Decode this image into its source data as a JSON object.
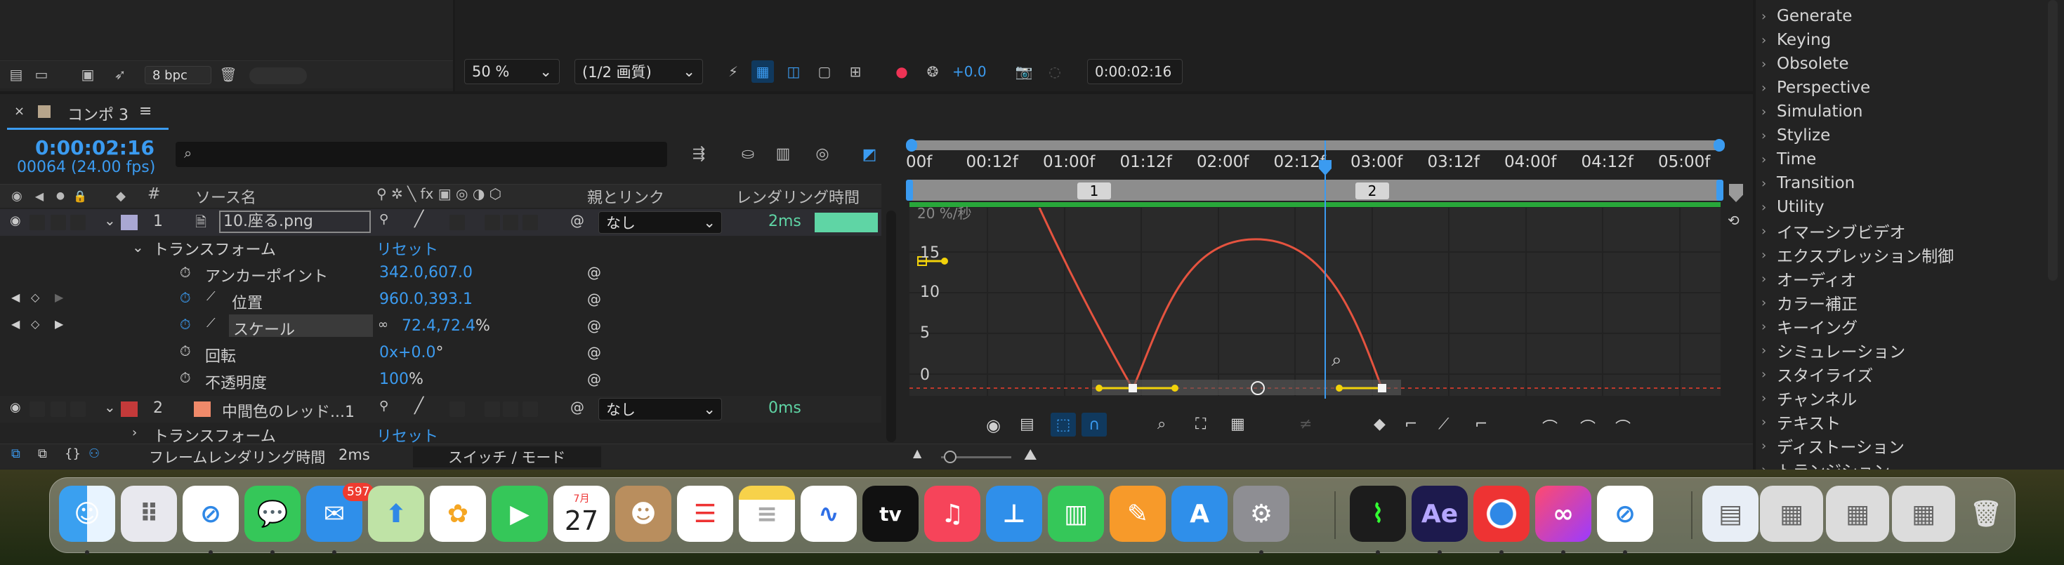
{
  "top_bar": {
    "bpc": "8 bpc"
  },
  "viewer_toolbar": {
    "zoom": "50 %",
    "resolution": "(1/2 画質)",
    "exposure": "+0.0",
    "timecode": "0:00:02:16"
  },
  "comp_tab": {
    "title": "コンポ 3"
  },
  "timeline": {
    "current_time": "0:00:02:16",
    "frame_info": "00064 (24.00 fps)",
    "col_source": "ソース名",
    "col_parent": "親とリンク",
    "col_render": "レンダリング時間",
    "col_num": "#",
    "layers": [
      {
        "num": "1",
        "name": "10.座る.png",
        "parent": "なし",
        "render": "2ms",
        "color": "#a9a7d3"
      },
      {
        "num": "2",
        "name": "中間色のレッド...1",
        "parent": "なし",
        "render": "0ms",
        "color": "#c43a3a"
      }
    ],
    "transform_label": "トランスフォーム",
    "reset": "リセット",
    "props": [
      {
        "name": "アンカーポイント",
        "value": "342.0,607.0"
      },
      {
        "name": "位置",
        "value": "960.0,393.1"
      },
      {
        "name": "スケール",
        "value": "72.4,72.4",
        "unit": "%"
      },
      {
        "name": "回転",
        "value": "0x+0.0",
        "unit": "°"
      },
      {
        "name": "不透明度",
        "value": "100",
        "unit": "%"
      }
    ],
    "transform2": "トランスフォーム",
    "reset2": "リセット",
    "footer_render_label": "フレームレンダリング時間",
    "footer_render_value": "2ms",
    "footer_switch": "スイッチ / モード"
  },
  "ruler": {
    "ticks": [
      "00f",
      "00:12f",
      "01:00f",
      "01:12f",
      "02:00f",
      "02:12f",
      "03:00f",
      "03:12f",
      "04:00f",
      "04:12f",
      "05:00f"
    ],
    "marker1": "1",
    "marker2": "2"
  },
  "graph": {
    "y_labels": [
      "20 %/秒",
      "15",
      "10",
      "5",
      "0"
    ]
  },
  "effects": [
    "Generate",
    "Keying",
    "Obsolete",
    "Perspective",
    "Simulation",
    "Stylize",
    "Time",
    "Transition",
    "Utility",
    "イマーシブビデオ",
    "エクスプレッション制御",
    "オーディオ",
    "カラー補正",
    "キーイング",
    "シミュレーション",
    "スタイライズ",
    "チャンネル",
    "テキスト",
    "ディストーション",
    "トランジション"
  ],
  "dock": {
    "mail_badge": "597",
    "calendar_month": "7月",
    "calendar_day": "27",
    "tv_label": "tv",
    "ae_label": "Ae",
    "apps": [
      "Finder",
      "Launchpad",
      "Safari",
      "Messages",
      "Mail",
      "Maps",
      "Photos",
      "FaceTime",
      "Calendar",
      "Contacts",
      "Reminders",
      "Notes",
      "Freeform",
      "Apple TV",
      "Music",
      "Keynote",
      "Numbers",
      "Pages",
      "App Store",
      "System Settings",
      "Activity Monitor",
      "After Effects",
      "Chrome",
      "Creative Cloud",
      "Safari Technology Preview"
    ]
  }
}
